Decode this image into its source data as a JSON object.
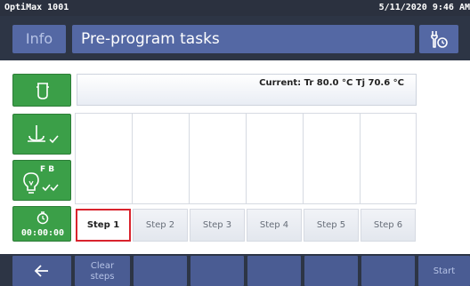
{
  "status_bar": {
    "device": "OptiMax 1001",
    "datetime": "5/11/2020 9:46 AM"
  },
  "header": {
    "info_label": "Info",
    "title": "Pre-program tasks",
    "tool_icon": "wrench-clock-icon"
  },
  "sidebar": {
    "buttons": [
      {
        "icon": "reactor-vessel-icon"
      },
      {
        "icon": "stirrer-check-icon"
      },
      {
        "icon": "bulb-fb-check-icon"
      },
      {
        "icon": "timer-icon",
        "label": "00:00:00"
      }
    ],
    "bulb_letters": "F B"
  },
  "readout": {
    "current": "Current: Tr 80.0 °C  Tj 70.6 °C"
  },
  "steps": [
    "Step 1",
    "Step 2",
    "Step 3",
    "Step 4",
    "Step 5",
    "Step 6"
  ],
  "active_step": "Step 1",
  "footer": {
    "back_icon": "arrow-left-icon",
    "clear_line1": "Clear",
    "clear_line2": "steps",
    "start_label": "Start"
  },
  "colors": {
    "accent_blue": "#5468a4",
    "green": "#3b9f48",
    "active_border": "#d9232d",
    "dark_bg": "#2d3545"
  }
}
